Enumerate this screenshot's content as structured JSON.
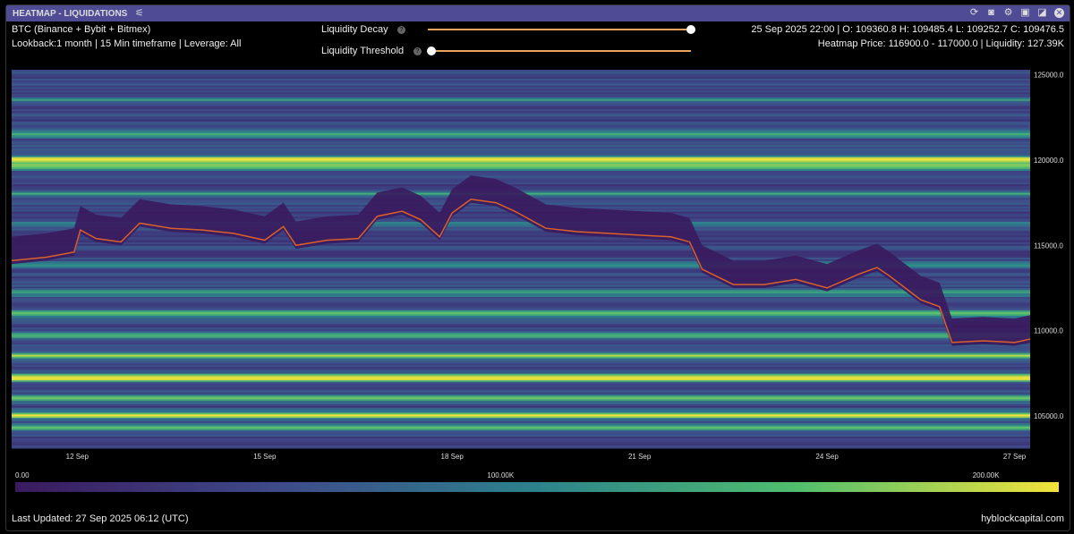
{
  "window": {
    "title": "HEATMAP - LIQUIDATIONS",
    "icons": [
      "settings-sliders-icon",
      "refresh-icon",
      "camera-icon",
      "gear-icon",
      "save-icon",
      "expand-icon",
      "close-icon"
    ]
  },
  "info": {
    "symbol": "BTC (Binance + Bybit + Bitmex)",
    "params": "Lookback:1 month | 15 Min timeframe | Leverage: All",
    "ohlc": "25 Sep 2025 22:00 | O: 109360.8 H: 109485.4 L: 109252.7 C: 109476.5",
    "hover": "Heatmap Price: 116900.0 - 117000.0 | Liquidity: 127.39K"
  },
  "controls": {
    "decay_label": "Liquidity Decay",
    "decay_value": 1.0,
    "threshold_label": "Liquidity Threshold",
    "threshold_value": 0.0
  },
  "footer": {
    "updated": "Last Updated: 27 Sep 2025 06:12 (UTC)",
    "brand": "hyblockcapital.com"
  },
  "colors": {
    "low": "#3a1a5e",
    "mid": "#2f8d8c",
    "high": "#f2e33a",
    "price": "#d9612a"
  },
  "chart_data": {
    "type": "heatmap",
    "title": "HEATMAP - LIQUIDATIONS",
    "x_ticks": [
      "12 Sep",
      "15 Sep",
      "18 Sep",
      "21 Sep",
      "24 Sep",
      "27 Sep"
    ],
    "x_tick_days": [
      12,
      15,
      18,
      21,
      24,
      27
    ],
    "xlim_days": [
      10.95,
      27.25
    ],
    "y_ticks": [
      "125000.0",
      "120000.0",
      "115000.0",
      "110000.0",
      "105000.0"
    ],
    "y_tick_values": [
      125000,
      120000,
      115000,
      110000,
      105000
    ],
    "ylim": [
      103100,
      125300
    ],
    "colorbar": {
      "labels": [
        "0.00",
        "100.00K",
        "200.00K"
      ],
      "values": [
        0,
        100000,
        200000
      ],
      "max": 215000
    },
    "liquidity_levels": [
      {
        "price": 120000,
        "liquidity": 170000
      },
      {
        "price": 119600,
        "liquidity": 120000
      },
      {
        "price": 121500,
        "liquidity": 90000
      },
      {
        "price": 118000,
        "liquidity": 80000
      },
      {
        "price": 116200,
        "liquidity": 70000
      },
      {
        "price": 113800,
        "liquidity": 60000
      },
      {
        "price": 112200,
        "liquidity": 90000
      },
      {
        "price": 111000,
        "liquidity": 110000
      },
      {
        "price": 109700,
        "liquidity": 100000
      },
      {
        "price": 108500,
        "liquidity": 150000
      },
      {
        "price": 107200,
        "liquidity": 210000
      },
      {
        "price": 106000,
        "liquidity": 120000
      },
      {
        "price": 105000,
        "liquidity": 170000
      },
      {
        "price": 104300,
        "liquidity": 110000
      },
      {
        "price": 123500,
        "liquidity": 60000
      }
    ],
    "price_series": {
      "name": "BTC price",
      "days": [
        10.95,
        11.5,
        11.95,
        12.05,
        12.3,
        12.7,
        13.0,
        13.5,
        14,
        14.5,
        15,
        15.3,
        15.5,
        16,
        16.5,
        16.8,
        17.2,
        17.5,
        17.8,
        18.0,
        18.3,
        18.7,
        19,
        19.5,
        20,
        20.5,
        21,
        21.5,
        21.8,
        22.0,
        22.5,
        23,
        23.5,
        24,
        24.5,
        24.8,
        25,
        25.5,
        25.8,
        26.0,
        26.5,
        27,
        27.25
      ],
      "values": [
        114100,
        114300,
        114600,
        115900,
        115400,
        115200,
        116300,
        116000,
        115900,
        115700,
        115300,
        116100,
        115000,
        115300,
        115400,
        116700,
        117000,
        116500,
        115500,
        116900,
        117700,
        117500,
        117000,
        116000,
        115800,
        115700,
        115600,
        115500,
        115200,
        113600,
        112700,
        112700,
        113000,
        112500,
        113300,
        113700,
        113200,
        111800,
        111400,
        109300,
        109400,
        109300,
        109500
      ]
    }
  }
}
